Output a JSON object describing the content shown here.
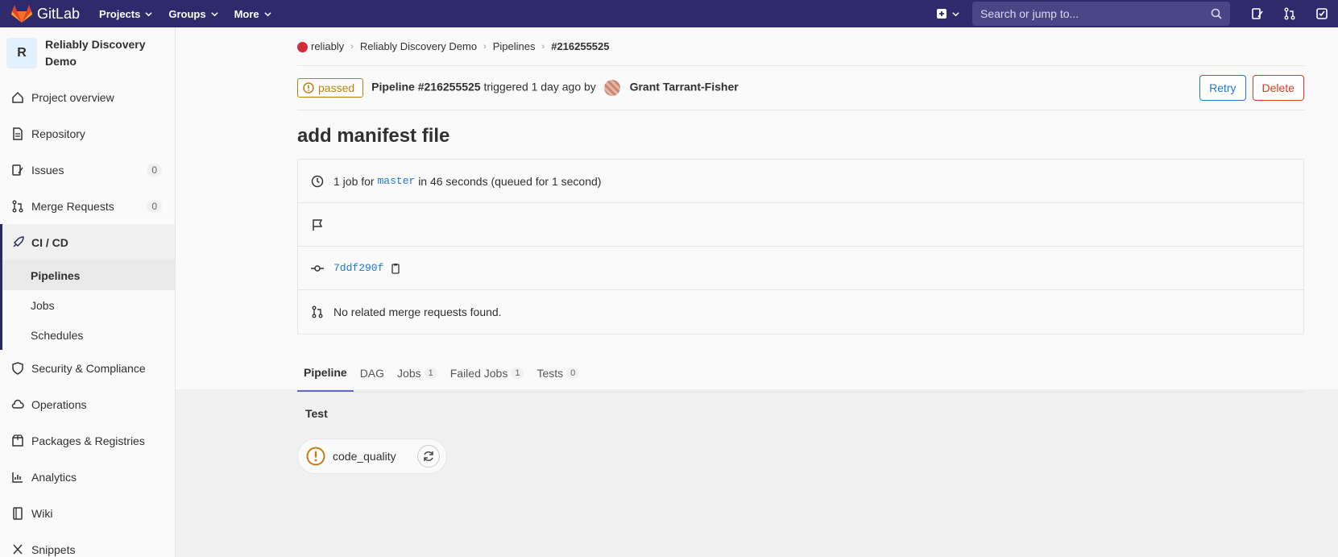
{
  "topbar": {
    "brand": "GitLab",
    "nav": [
      {
        "label": "Projects"
      },
      {
        "label": "Groups"
      },
      {
        "label": "More"
      }
    ],
    "search_placeholder": "Search or jump to..."
  },
  "sidebar": {
    "project_initial": "R",
    "project_name": "Reliably Discovery Demo",
    "items": [
      {
        "label": "Project overview",
        "icon": "home-icon"
      },
      {
        "label": "Repository",
        "icon": "doc-icon"
      },
      {
        "label": "Issues",
        "icon": "issues-icon",
        "count": "0"
      },
      {
        "label": "Merge Requests",
        "icon": "merge-request-icon",
        "count": "0"
      },
      {
        "label": "CI / CD",
        "icon": "rocket-icon"
      },
      {
        "label": "Security & Compliance",
        "icon": "shield-icon"
      },
      {
        "label": "Operations",
        "icon": "cloud-icon"
      },
      {
        "label": "Packages & Registries",
        "icon": "package-icon"
      },
      {
        "label": "Analytics",
        "icon": "chart-icon"
      },
      {
        "label": "Wiki",
        "icon": "book-icon"
      },
      {
        "label": "Snippets",
        "icon": "scissors-icon"
      }
    ],
    "cicd_sub": [
      "Pipelines",
      "Jobs",
      "Schedules"
    ]
  },
  "breadcrumb": {
    "group": "reliably",
    "project": "Reliably Discovery Demo",
    "section": "Pipelines",
    "current": "#216255525"
  },
  "pipeline": {
    "status": "passed",
    "name": "Pipeline #216255525",
    "triggered_text": "triggered 1 day ago by",
    "user": "Grant Tarrant-Fisher",
    "retry_label": "Retry",
    "delete_label": "Delete",
    "title": "add manifest file",
    "jobs_prefix": "1 job for",
    "branch": "master",
    "jobs_suffix": "in 46 seconds (queued for 1 second)",
    "commit": "7ddf290f",
    "mr_text": "No related merge requests found."
  },
  "tabs": [
    {
      "label": "Pipeline"
    },
    {
      "label": "DAG"
    },
    {
      "label": "Jobs",
      "count": "1"
    },
    {
      "label": "Failed Jobs",
      "count": "1"
    },
    {
      "label": "Tests",
      "count": "0"
    }
  ],
  "stage": {
    "title": "Test",
    "job": "code_quality"
  },
  "colors": {
    "navbar": "#2f2a6b",
    "warning": "#c17d10",
    "link": "#1f78d1",
    "danger": "#db3b21"
  }
}
